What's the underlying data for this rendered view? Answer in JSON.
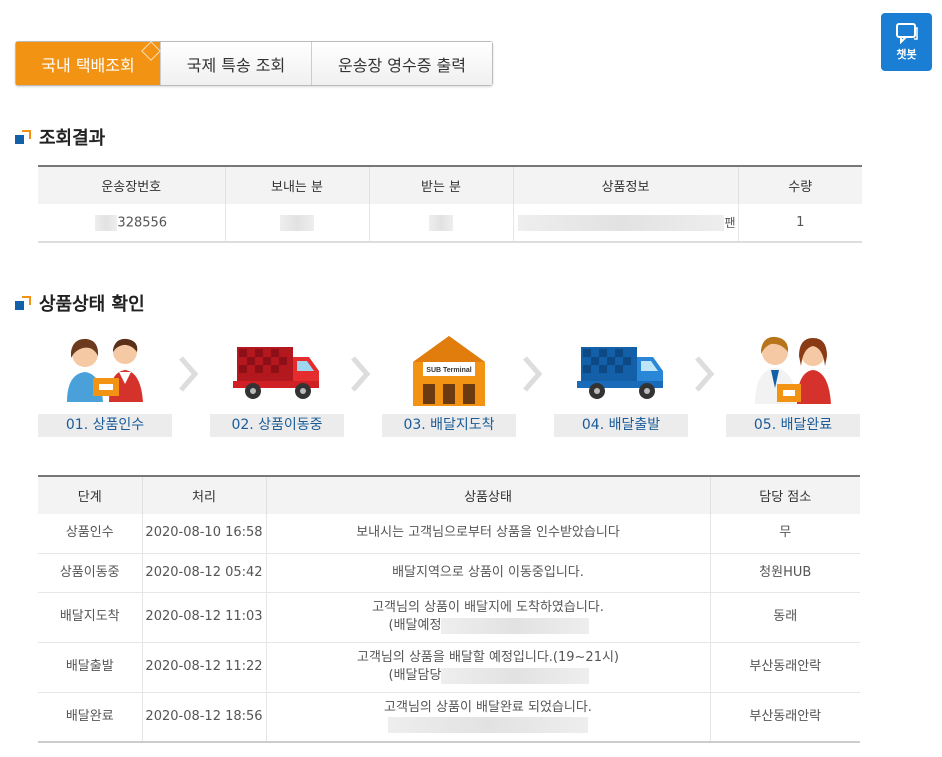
{
  "tabs": [
    {
      "label": "국내 택배조회",
      "active": true
    },
    {
      "label": "국제 특송 조회",
      "active": false
    },
    {
      "label": "운송장 영수증 출력",
      "active": false
    }
  ],
  "chatbot": {
    "label": "챗봇",
    "color": "#1a7fd4"
  },
  "section_result": {
    "title": "조회결과"
  },
  "result_table": {
    "headers": [
      "운송장번호",
      "보내는 분",
      "받는 분",
      "상품정보",
      "수량"
    ],
    "row": {
      "tracking_visible": "328556",
      "product_tail": "팬",
      "qty": "1"
    }
  },
  "section_status": {
    "title": "상품상태 확인"
  },
  "steps": [
    {
      "label": "01. 상품인수",
      "icon": "handover-icon"
    },
    {
      "label": "02. 상품이동중",
      "icon": "red-truck-icon"
    },
    {
      "label": "03. 배달지도착",
      "icon": "sub-terminal-icon",
      "sign": "SUB Terminal"
    },
    {
      "label": "04. 배달출발",
      "icon": "blue-truck-icon"
    },
    {
      "label": "05. 배달완료",
      "icon": "delivered-icon"
    }
  ],
  "status_table": {
    "headers": [
      "단계",
      "처리",
      "상품상태",
      "담당 점소"
    ],
    "rows": [
      {
        "stage": "상품인수",
        "time": "2020-08-10 16:58",
        "status": "보내시는 고객님으로부터 상품을 인수받았습니다",
        "status2": "",
        "office": "무"
      },
      {
        "stage": "상품이동중",
        "time": "2020-08-12 05:42",
        "status": "배달지역으로 상품이 이동중입니다.",
        "status2": "",
        "office": "청원HUB"
      },
      {
        "stage": "배달지도착",
        "time": "2020-08-12 11:03",
        "status": "고객님의 상품이 배달지에 도착하였습니다.",
        "status2": "(배달예정",
        "office": "동래"
      },
      {
        "stage": "배달출발",
        "time": "2020-08-12 11:22",
        "status": "고객님의 상품을 배달할 예정입니다.(19~21시)",
        "status2": "(배달담당",
        "office": "부산동래안락"
      },
      {
        "stage": "배달완료",
        "time": "2020-08-12 18:56",
        "status": "고객님의 상품이 배달완료 되었습니다.",
        "status2": "",
        "office": "부산동래안락"
      }
    ]
  },
  "colors": {
    "accent": "#f39314",
    "brand_blue": "#1460a8"
  }
}
